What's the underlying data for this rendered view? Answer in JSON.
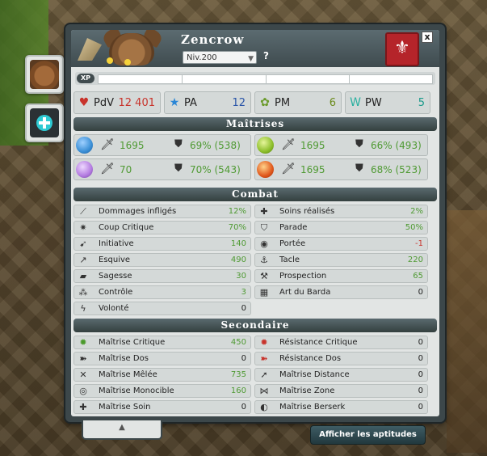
{
  "character": {
    "name": "Zencrow",
    "level": "Niv.200",
    "help": "?",
    "close": "x",
    "xp_badge": "XP"
  },
  "main_stats": [
    {
      "icon": "heart-icon",
      "label": "PdV",
      "value": "12 401",
      "color": "#c8332b"
    },
    {
      "icon": "star-icon",
      "label": "PA",
      "value": "12",
      "color": "#2a55a8"
    },
    {
      "icon": "movement-icon",
      "label": "PM",
      "value": "6",
      "color": "#6a8a1a"
    },
    {
      "icon": "wakfu-icon",
      "label": "PW",
      "value": "5",
      "color": "#1a9a8a"
    }
  ],
  "sections": {
    "masteries": "Maîtrises",
    "combat": "Combat",
    "secondary": "Secondaire"
  },
  "masteries": [
    {
      "element": "water-orb-icon",
      "color": "#3a8fd6",
      "mastery": "1695",
      "resistance": "69% (538)"
    },
    {
      "element": "earth-orb-icon",
      "color": "#8cbe2a",
      "mastery": "1695",
      "resistance": "66% (493)"
    },
    {
      "element": "air-orb-icon",
      "color": "#b37be0",
      "mastery": "70",
      "resistance": "70% (543)"
    },
    {
      "element": "fire-orb-icon",
      "color": "#e0581c",
      "mastery": "1695",
      "resistance": "68% (523)"
    }
  ],
  "combat_left": [
    {
      "icon": "damage-icon",
      "label": "Dommages infligés",
      "value": "12%"
    },
    {
      "icon": "critical-icon",
      "label": "Coup Critique",
      "value": "70%"
    },
    {
      "icon": "initiative-icon",
      "label": "Initiative",
      "value": "140"
    },
    {
      "icon": "dodge-icon",
      "label": "Esquive",
      "value": "490"
    },
    {
      "icon": "wisdom-icon",
      "label": "Sagesse",
      "value": "30"
    },
    {
      "icon": "control-icon",
      "label": "Contrôle",
      "value": "3"
    },
    {
      "icon": "willpower-icon",
      "label": "Volonté",
      "value": "0"
    }
  ],
  "combat_right": [
    {
      "icon": "heal-icon",
      "label": "Soins réalisés",
      "value": "2%"
    },
    {
      "icon": "block-icon",
      "label": "Parade",
      "value": "50%"
    },
    {
      "icon": "range-icon",
      "label": "Portée",
      "value": "-1"
    },
    {
      "icon": "lock-icon",
      "label": "Tacle",
      "value": "220"
    },
    {
      "icon": "prospecting-icon",
      "label": "Prospection",
      "value": "65"
    },
    {
      "icon": "barda-icon",
      "label": "Art du Barda",
      "value": "0"
    }
  ],
  "secondary_left": [
    {
      "icon": "critical-mastery-icon",
      "label": "Maîtrise Critique",
      "value": "450"
    },
    {
      "icon": "rear-mastery-icon",
      "label": "Maîtrise Dos",
      "value": "0"
    },
    {
      "icon": "melee-mastery-icon",
      "label": "Maîtrise Mêlée",
      "value": "735"
    },
    {
      "icon": "single-target-mastery-icon",
      "label": "Maîtrise Monocible",
      "value": "160"
    },
    {
      "icon": "heal-mastery-icon",
      "label": "Maîtrise Soin",
      "value": "0"
    }
  ],
  "secondary_right": [
    {
      "icon": "critical-resistance-icon",
      "label": "Résistance Critique",
      "value": "0"
    },
    {
      "icon": "rear-resistance-icon",
      "label": "Résistance Dos",
      "value": "0"
    },
    {
      "icon": "distance-mastery-icon",
      "label": "Maîtrise Distance",
      "value": "0"
    },
    {
      "icon": "area-mastery-icon",
      "label": "Maîtrise Zone",
      "value": "0"
    },
    {
      "icon": "berserk-mastery-icon",
      "label": "Maîtrise Berserk",
      "value": "0"
    }
  ],
  "footer": {
    "collapse": "▲",
    "aptitudes_button": "Afficher les aptitudes"
  }
}
